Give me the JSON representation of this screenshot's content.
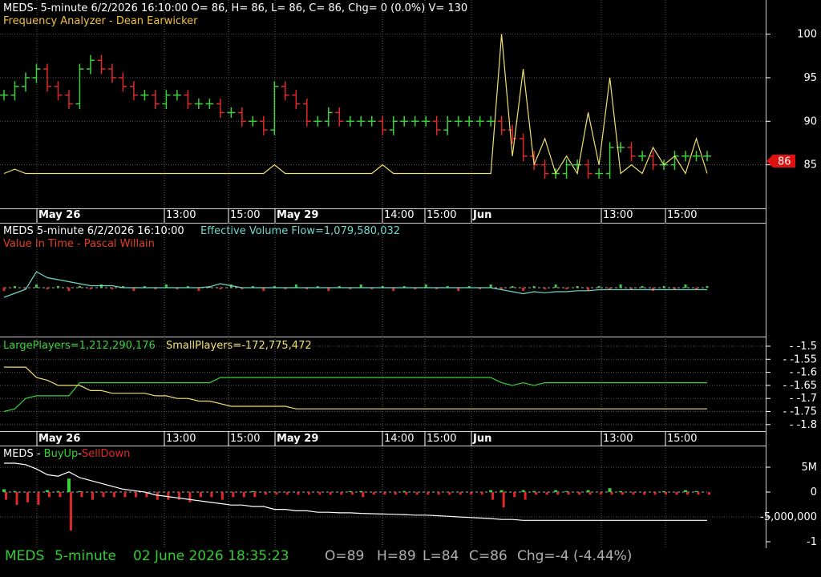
{
  "colors": {
    "background": "#000000",
    "grid": "#5a5a5a",
    "up": "#3bd13b",
    "down": "#e02828",
    "price_line": "#f0e070",
    "flow_line": "#6fd8c8",
    "large_players": "#3bd13b",
    "small_players": "#f0e070",
    "status_green": "#33cc33",
    "status_grey": "#b0b0b0",
    "white": "#ffffff",
    "red_label": "#e04020"
  },
  "panel1": {
    "header": "MEDS- 5-minute 6/2/2026 16:10:00 O= 86, H= 86, L= 86, C= 86, Chg= 0 (0.0%) V= 130",
    "subheader": "Frequency Analyzer - Dean Earwicker",
    "price_tag": "86"
  },
  "panel2": {
    "header_symbol": "MEDS 5-minute  6/2/2026 16:10:00",
    "header_flow": "Effective Volume Flow=1,079,580,032",
    "subheader": "Value In Time - Pascal Willain"
  },
  "panel3": {
    "large_label": "LargePlayers=1,212,290,176",
    "small_label": "SmallPlayers=-172,775,472"
  },
  "panel4": {
    "symbol": "MEDS",
    "dash1": " - ",
    "buy_label": "BuyUp",
    "dash2": "-",
    "sell_label": "SellDown"
  },
  "x_axis_labels": [
    {
      "text": "May 26",
      "bold": true
    },
    {
      "text": "13:00",
      "bold": false
    },
    {
      "text": "15:00",
      "bold": false
    },
    {
      "text": "May 29",
      "bold": true
    },
    {
      "text": "14:00",
      "bold": false
    },
    {
      "text": "15:00",
      "bold": false
    },
    {
      "text": "Jun",
      "bold": true
    },
    {
      "text": "13:00",
      "bold": false
    },
    {
      "text": "15:00",
      "bold": false
    }
  ],
  "status_bar": {
    "symbol": "MEDS",
    "interval": "5-minute",
    "datetime": "02 June 2026 18:35:23",
    "open": "O=89",
    "high": "H=89",
    "low": "L=84",
    "close": "C=86",
    "change": "Chg=-4 (-4.44%)"
  },
  "chart_data": [
    {
      "type": "line",
      "title": "MEDS- 5-minute 6/2/2026 16:10:00 O= 86, H= 86, L= 86, C= 86, Chg= 0 (0.0%) V= 130",
      "description_series": [
        "price bars (OHLC)",
        "Frequency Analyzer"
      ],
      "ylim": [
        80,
        103
      ],
      "yticks": [
        85,
        90,
        95,
        100
      ],
      "x_ticks": [
        "May 26",
        "13:00",
        "15:00",
        "May 29",
        "14:00",
        "15:00",
        "Jun",
        "13:00",
        "15:00"
      ],
      "price_close": [
        93,
        94,
        95,
        96,
        94,
        93,
        92,
        96,
        97,
        96,
        95,
        94,
        93,
        93,
        92,
        93,
        93,
        92,
        92,
        92,
        91,
        91,
        90,
        90,
        89,
        94,
        93,
        92,
        90,
        90,
        91,
        90,
        90,
        90,
        90,
        89,
        90,
        90,
        90,
        90,
        89,
        90,
        90,
        90,
        90,
        90,
        89,
        88,
        86,
        85,
        84,
        84,
        85,
        85,
        84,
        84,
        87,
        87,
        86,
        86,
        85,
        85,
        86,
        86,
        86,
        86
      ],
      "series": [
        {
          "name": "Frequency Analyzer",
          "values": [
            84,
            84.5,
            84,
            84,
            84,
            84,
            84,
            84,
            84,
            84,
            84,
            84,
            84,
            84,
            84,
            84,
            84,
            84,
            84,
            84,
            84,
            84,
            84,
            84,
            84,
            85,
            84,
            84,
            84,
            84,
            84,
            84,
            84,
            84,
            84,
            85,
            84,
            84,
            84,
            84,
            84,
            84,
            84,
            84,
            84,
            84,
            100,
            86,
            96,
            85,
            88,
            84,
            86,
            84,
            91,
            85,
            95,
            84,
            85,
            84,
            87,
            85,
            86,
            84,
            88,
            84
          ]
        }
      ],
      "last_value": 86
    },
    {
      "type": "bar",
      "title": "Value In Time - Pascal Willain",
      "series": [
        {
          "name": "Effective Volume Flow",
          "values": [
            0,
            0.2,
            0.4,
            0.8,
            0.5,
            0.4,
            0.3,
            0.2,
            0.1,
            0.1,
            0.1,
            0,
            0,
            0,
            0,
            0,
            0,
            0,
            0,
            0.05,
            0.2,
            0.1,
            0,
            0,
            0,
            0,
            0,
            0,
            0,
            0,
            0,
            0,
            0,
            0,
            0,
            0,
            0,
            0,
            0,
            0,
            0,
            0,
            0,
            0,
            0,
            0,
            -0.1,
            -0.2,
            -0.3,
            -0.2,
            -0.25,
            -0.2,
            -0.2,
            -0.15,
            -0.15,
            -0.1,
            -0.1,
            -0.1,
            -0.1,
            -0.1,
            -0.1,
            -0.1,
            -0.1,
            -0.1,
            -0.1,
            -0.1
          ]
        }
      ],
      "flow_value": "1,079,580,032"
    },
    {
      "type": "line",
      "title": "",
      "ylim": [
        -1.82,
        -1.48
      ],
      "yticks": [
        -1.5,
        -1.55,
        -1.6,
        -1.65,
        -1.7,
        -1.75,
        -1.8
      ],
      "series": [
        {
          "name": "LargePlayers",
          "values": [
            -1.75,
            -1.74,
            -1.7,
            -1.69,
            -1.69,
            -1.69,
            -1.69,
            -1.64,
            -1.64,
            -1.64,
            -1.64,
            -1.64,
            -1.64,
            -1.64,
            -1.64,
            -1.64,
            -1.64,
            -1.64,
            -1.64,
            -1.64,
            -1.62,
            -1.62,
            -1.62,
            -1.62,
            -1.62,
            -1.62,
            -1.62,
            -1.62,
            -1.62,
            -1.62,
            -1.62,
            -1.62,
            -1.62,
            -1.62,
            -1.62,
            -1.62,
            -1.62,
            -1.62,
            -1.62,
            -1.62,
            -1.62,
            -1.62,
            -1.62,
            -1.62,
            -1.62,
            -1.62,
            -1.64,
            -1.65,
            -1.64,
            -1.65,
            -1.64,
            -1.64,
            -1.64,
            -1.64,
            -1.64,
            -1.64,
            -1.64,
            -1.64,
            -1.64,
            -1.64,
            -1.64,
            -1.64,
            -1.64,
            -1.64,
            -1.64,
            -1.64
          ]
        },
        {
          "name": "SmallPlayers",
          "values": [
            -1.58,
            -1.58,
            -1.58,
            -1.62,
            -1.63,
            -1.65,
            -1.65,
            -1.65,
            -1.67,
            -1.67,
            -1.68,
            -1.68,
            -1.68,
            -1.68,
            -1.69,
            -1.69,
            -1.7,
            -1.7,
            -1.71,
            -1.71,
            -1.72,
            -1.73,
            -1.73,
            -1.73,
            -1.73,
            -1.73,
            -1.73,
            -1.74,
            -1.74,
            -1.74,
            -1.74,
            -1.74,
            -1.74,
            -1.74,
            -1.74,
            -1.74,
            -1.74,
            -1.74,
            -1.74,
            -1.74,
            -1.74,
            -1.74,
            -1.74,
            -1.74,
            -1.74,
            -1.74,
            -1.74,
            -1.74,
            -1.74,
            -1.74,
            -1.74,
            -1.74,
            -1.74,
            -1.74,
            -1.74,
            -1.74,
            -1.74,
            -1.74,
            -1.74,
            -1.74,
            -1.74,
            -1.74,
            -1.74,
            -1.74,
            -1.74,
            -1.74
          ]
        }
      ],
      "large_value": "1,212,290,176",
      "small_value": "-172,775,472"
    },
    {
      "type": "bar",
      "title": "MEDS - BuyUp-SellDown",
      "ytick_labels": [
        "5M",
        "0",
        "-5,000,000",
        "-1"
      ],
      "series": [
        {
          "name": "BuyUp",
          "values": [
            0.3,
            0.1,
            0,
            0,
            0.2,
            0.1,
            1.4,
            0.1,
            0,
            0,
            0,
            0,
            0,
            0,
            0,
            0,
            0,
            0,
            0,
            0,
            0,
            0,
            0,
            0.1,
            0,
            0,
            0,
            0,
            0,
            0,
            0,
            0,
            0.1,
            0.1,
            0,
            0,
            0,
            0.1,
            0,
            0,
            0,
            0,
            0,
            0,
            0,
            0.2,
            0.2,
            0,
            0.2,
            0.1,
            0,
            0.2,
            0.1,
            0,
            0.2,
            0,
            0.4,
            0.1,
            0,
            0,
            0,
            0.1,
            0,
            0.2,
            0.1,
            0
          ]
        },
        {
          "name": "SellDown",
          "values": [
            -0.3,
            -0.5,
            -0.4,
            -0.5,
            -0.2,
            -0.2,
            -1.5,
            -0.2,
            -0.3,
            -0.2,
            -0.2,
            -0.2,
            -0.2,
            -0.2,
            -0.3,
            -0.3,
            -0.3,
            -0.4,
            -0.2,
            -0.2,
            -0.3,
            -0.2,
            -0.2,
            -0.2,
            -0.1,
            -0.1,
            -0.1,
            -0.1,
            -0.1,
            -0.1,
            -0.1,
            -0.1,
            -0.1,
            -0.2,
            -0.1,
            -0.1,
            -0.1,
            -0.1,
            -0.1,
            -0.1,
            -0.1,
            -0.1,
            -0.1,
            -0.1,
            -0.1,
            -0.3,
            -0.6,
            -0.2,
            -0.3,
            -0.1,
            -0.1,
            -0.1,
            -0.1,
            -0.1,
            -0.1,
            -0.1,
            -0.1,
            -0.1,
            -0.1,
            -0.1,
            -0.1,
            -0.1,
            -0.1,
            -0.1,
            -0.1,
            -0.1
          ]
        },
        {
          "name": "cumulative",
          "values": [
            1.0,
            1.0,
            0.95,
            0.8,
            0.6,
            0.55,
            0.7,
            0.5,
            0.4,
            0.3,
            0.2,
            0.1,
            0.05,
            0,
            -0.1,
            -0.15,
            -0.2,
            -0.25,
            -0.3,
            -0.35,
            -0.4,
            -0.45,
            -0.45,
            -0.5,
            -0.5,
            -0.6,
            -0.6,
            -0.65,
            -0.65,
            -0.7,
            -0.7,
            -0.72,
            -0.72,
            -0.74,
            -0.75,
            -0.76,
            -0.77,
            -0.78,
            -0.8,
            -0.8,
            -0.82,
            -0.84,
            -0.86,
            -0.88,
            -0.9,
            -0.92,
            -0.95,
            -0.95,
            -0.98,
            -0.98,
            -0.98,
            -0.98,
            -0.98,
            -0.98,
            -0.98,
            -0.98,
            -0.98,
            -0.98,
            -0.98,
            -0.98,
            -0.98,
            -0.98,
            -0.98,
            -0.98,
            -0.98,
            -0.98
          ]
        }
      ]
    }
  ]
}
